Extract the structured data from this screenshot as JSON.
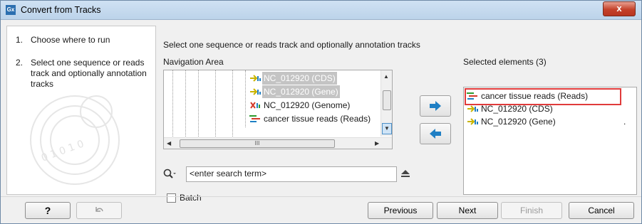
{
  "window": {
    "title": "Convert from Tracks",
    "app_icon": "Gx",
    "close_label": "x"
  },
  "steps": [
    {
      "num": "1.",
      "label": "Choose where to run"
    },
    {
      "num": "2.",
      "label": "Select one sequence or reads track and optionally annotation tracks"
    }
  ],
  "instruction": "Select one sequence or reads track and optionally annotation tracks",
  "navigation": {
    "label": "Navigation Area",
    "items": [
      {
        "label": "NC_012920 (CDS)",
        "icon": "annotation-track-icon",
        "dimmed": true
      },
      {
        "label": "NC_012920 (Gene)",
        "icon": "annotation-track-icon",
        "dimmed": true
      },
      {
        "label": "NC_012920 (Genome)",
        "icon": "genome-track-icon",
        "dimmed": false
      },
      {
        "label": "cancer tissue reads (Reads)",
        "icon": "reads-track-icon",
        "dimmed": false
      }
    ],
    "hscroll_grip": "III"
  },
  "search": {
    "placeholder": "<enter search term>"
  },
  "batch": {
    "label": "Batch",
    "checked": false
  },
  "selected": {
    "label": "Selected elements (3)",
    "items": [
      {
        "label": "cancer tissue reads (Reads)",
        "icon": "reads-track-icon",
        "highlighted": true
      },
      {
        "label": "NC_012920 (CDS)",
        "icon": "annotation-track-icon",
        "highlighted": false
      },
      {
        "label": "NC_012920 (Gene)",
        "icon": "annotation-track-icon",
        "highlighted": false
      }
    ],
    "trailing_mark": "."
  },
  "buttons": {
    "help": "?",
    "previous": "Previous",
    "next": "Next",
    "finish": "Finish",
    "cancel": "Cancel"
  },
  "colors": {
    "accent_blue": "#1f7fc4",
    "highlight_red": "#e03b3b",
    "annotation_yellow": "#d8c400",
    "reads_green": "#2e9b2e"
  }
}
